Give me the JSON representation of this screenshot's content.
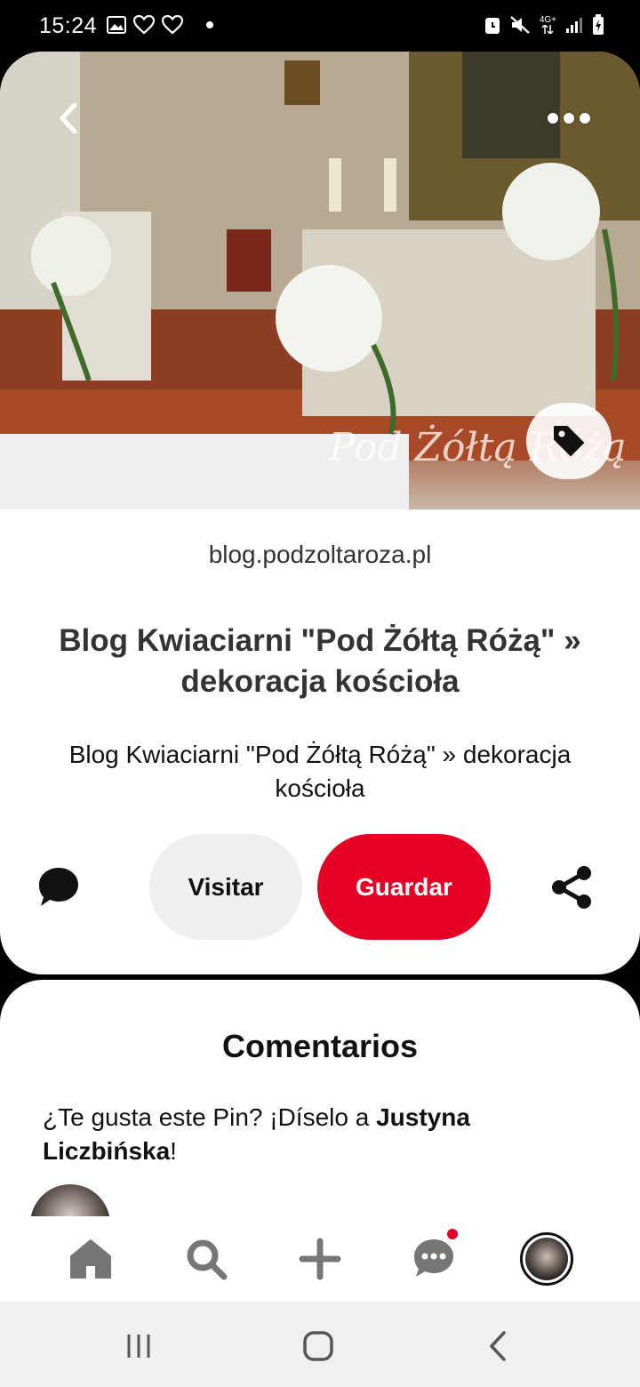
{
  "status_bar": {
    "time": "15:24",
    "left_icons": [
      "image-icon",
      "heart-outline-icon",
      "heart-outline-icon",
      "dot-icon"
    ],
    "network_label": "4G+",
    "right_icons": [
      "alarm-icon",
      "mute-icon",
      "signal-icon",
      "battery-charging-icon"
    ]
  },
  "pin": {
    "image_watermark": "Pod Żółtą Różą",
    "source": "blog.podzoltaroza.pl",
    "title": "Blog Kwiaciarni \"Pod Żółtą Różą\"   » dekoracja kościoła",
    "description": "Blog Kwiaciarni \"Pod Żółtą Różą\" » dekoracja kościoła",
    "actions": {
      "visit_label": "Visitar",
      "save_label": "Guardar"
    },
    "colors": {
      "save": "#e60023",
      "visit": "#efefef"
    }
  },
  "comments": {
    "title": "Comentarios",
    "prompt_prefix": "¿Te gusta este Pin? ¡Díselo a ",
    "prompt_user": "Justyna Liczbińska",
    "prompt_suffix": "!"
  },
  "bottom_nav": {
    "items": [
      "home-icon",
      "search-icon",
      "add-icon",
      "messages-icon",
      "profile-avatar"
    ],
    "notification_color": "#e60023"
  },
  "system_nav": {
    "items": [
      "recents-icon",
      "home-icon",
      "back-icon"
    ]
  }
}
